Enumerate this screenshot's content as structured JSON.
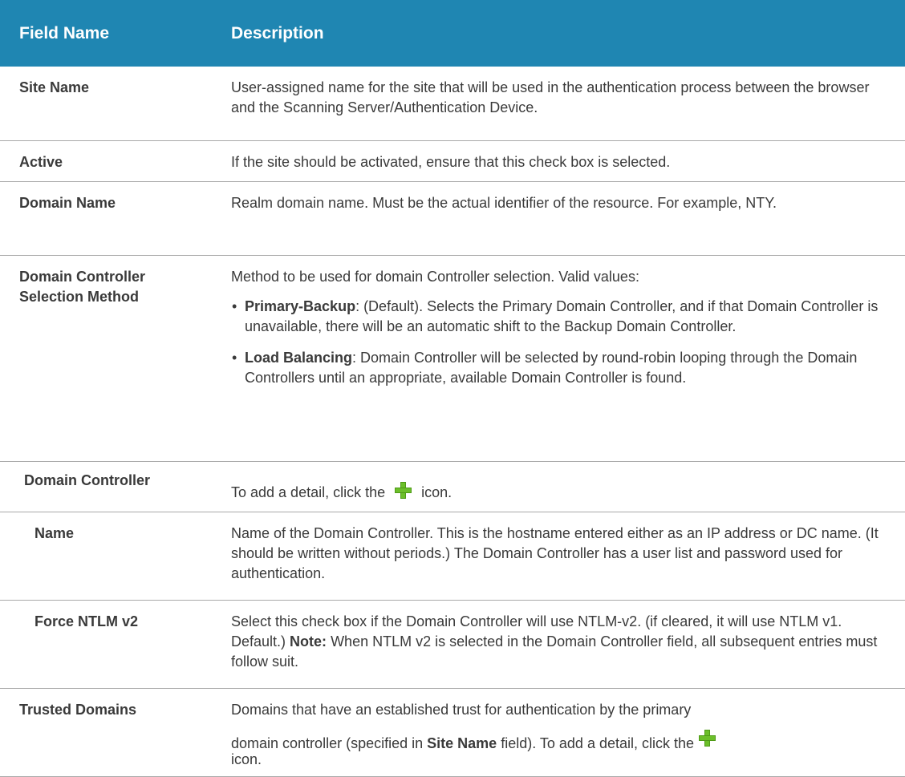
{
  "header": {
    "field_name": "Field Name",
    "description": "Description"
  },
  "rows": {
    "site_name": {
      "name": "Site Name",
      "desc": "User-assigned name for the site that will be used in the authentication process between the browser and the Scanning Server/Authentication Device."
    },
    "active": {
      "name": "Active",
      "desc": "If the site should be activated, ensure that this check box is selected."
    },
    "domain_name": {
      "name": "Domain Name",
      "desc": "Realm domain name. Must be the actual identifier of the resource. For example, NTY."
    },
    "dc_selection": {
      "name": "Domain Controller Selection Method",
      "desc": "Method to be used for domain Controller selection. Valid values:",
      "bullets": [
        {
          "term": "Primary-Backup",
          "text": ": (Default). Selects the Primary Domain Controller, and if that Domain Controller is unavailable, there will be an automatic shift to the Backup Domain Controller."
        },
        {
          "term": "Load Balancing",
          "text": ": Domain Controller will be selected by round-robin looping through the Domain Controllers until an appropriate, available Domain Controller is found."
        }
      ]
    },
    "domain_controller": {
      "name": "Domain Controller",
      "desc_before": "To add a detail, click the",
      "desc_after": "icon.",
      "icon": "plus-icon"
    },
    "dc_name": {
      "name": "Name",
      "desc": "Name of the Domain Controller. This is the hostname entered either as an IP address or DC name. (It should be written without periods.) The Domain Controller has a user list and password used for authentication."
    },
    "force_ntlm": {
      "name": "Force NTLM v2",
      "desc_before": "Select this check box if the Domain Controller will use NTLM-v2. (if cleared, it will use NTLM v1. Default.)",
      "note_label": "Note:",
      "desc_after": "When NTLM v2 is selected in the Domain Controller field, all subsequent entries must follow suit."
    },
    "trusted_domains": {
      "name": "Trusted Domains",
      "desc_line1": "Domains that have an established trust for authentication by the primary",
      "desc_before": "domain controller (specified in",
      "bold_ref": "Site Name",
      "desc_middle": "field). To add a detail, click the",
      "desc_after": "icon.",
      "icon": "plus-icon"
    }
  },
  "colors": {
    "header_bg": "#1f86b2",
    "header_text": "#ffffff",
    "body_text": "#3a3a3a",
    "row_divider": "#a9a9a9",
    "plus_icon": "#6cbf2a"
  }
}
